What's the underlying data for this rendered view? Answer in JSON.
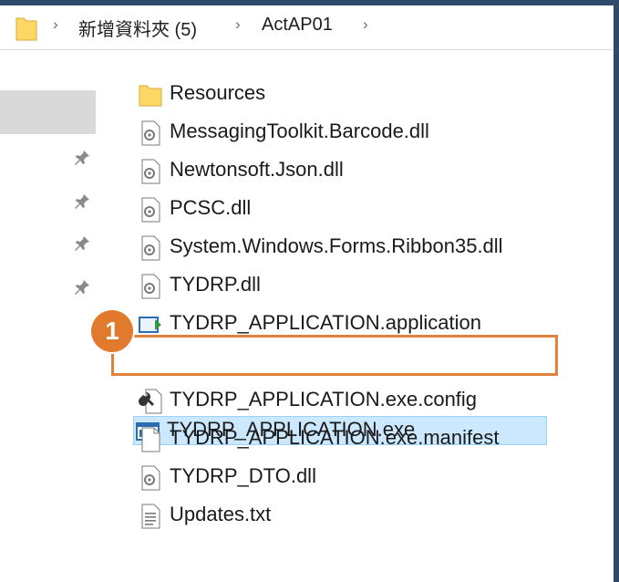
{
  "breadcrumb": {
    "folder_icon": "folder-icon",
    "items": [
      "新增資料夾 (5)",
      "ActAP01"
    ],
    "separator": "›"
  },
  "files": [
    {
      "name": "Resources",
      "icon": "folder-icon"
    },
    {
      "name": "MessagingToolkit.Barcode.dll",
      "icon": "dll-icon"
    },
    {
      "name": "Newtonsoft.Json.dll",
      "icon": "dll-icon"
    },
    {
      "name": "PCSC.dll",
      "icon": "dll-icon"
    },
    {
      "name": "System.Windows.Forms.Ribbon35.dll",
      "icon": "dll-icon"
    },
    {
      "name": "TYDRP.dll",
      "icon": "dll-icon"
    },
    {
      "name": "TYDRP_APPLICATION.application",
      "icon": "application-manifest-icon"
    },
    {
      "name": "TYDRP_APPLICATION.exe",
      "icon": "exe-icon"
    },
    {
      "name": "TYDRP_APPLICATION.exe.config",
      "icon": "config-icon"
    },
    {
      "name": "TYDRP_APPLICATION.exe.manifest",
      "icon": "blank-file-icon"
    },
    {
      "name": "TYDRP_DTO.dll",
      "icon": "dll-icon"
    },
    {
      "name": "Updates.txt",
      "icon": "text-file-icon"
    }
  ],
  "selected_file": "TYDRP_APPLICATION.exe",
  "step_badge": "1",
  "colors": {
    "highlight": "#e0823c",
    "selection": "#cce8ff",
    "badge": "#e27a2e"
  }
}
